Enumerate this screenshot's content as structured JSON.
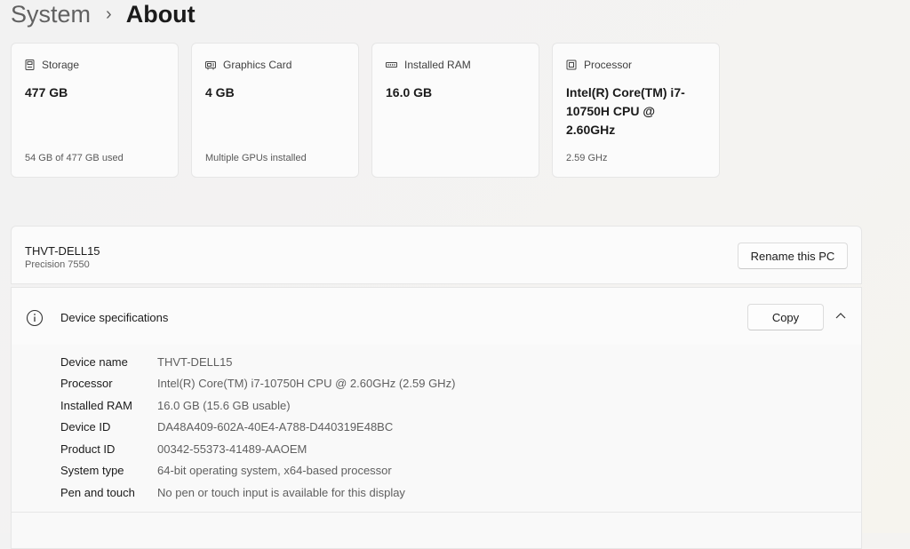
{
  "breadcrumb": {
    "parent": "System",
    "separator": "›",
    "current": "About"
  },
  "cards": {
    "storage": {
      "label": "Storage",
      "value": "477 GB",
      "detail": "54 GB of 477 GB used"
    },
    "graphics": {
      "label": "Graphics Card",
      "value": "4 GB",
      "detail": "Multiple GPUs installed"
    },
    "ram": {
      "label": "Installed RAM",
      "value": "16.0 GB"
    },
    "processor": {
      "label": "Processor",
      "value": "Intel(R) Core(TM) i7-10750H CPU @ 2.60GHz",
      "detail": "2.59 GHz"
    }
  },
  "pc": {
    "name": "THVT-DELL15",
    "model": "Precision 7550",
    "rename_label": "Rename this PC"
  },
  "specs": {
    "title": "Device specifications",
    "copy_label": "Copy",
    "expanded": true,
    "rows": [
      {
        "label": "Device name",
        "value": "THVT-DELL15"
      },
      {
        "label": "Processor",
        "value": "Intel(R) Core(TM) i7-10750H CPU @ 2.60GHz (2.59 GHz)"
      },
      {
        "label": "Installed RAM",
        "value": "16.0 GB (15.6 GB usable)"
      },
      {
        "label": "Device ID",
        "value": "DA48A409-602A-40E4-A788-D440319E48BC"
      },
      {
        "label": "Product ID",
        "value": "00342-55373-41489-AAOEM"
      },
      {
        "label": "System type",
        "value": "64-bit operating system, x64-based processor"
      },
      {
        "label": "Pen and touch",
        "value": "No pen or touch input is available for this display"
      }
    ]
  },
  "icons": {
    "storage": "storage-icon",
    "graphics": "graphics-card-icon",
    "ram": "ram-icon",
    "processor": "processor-icon",
    "info": "info-icon",
    "chevron": "chevron-up-icon"
  }
}
